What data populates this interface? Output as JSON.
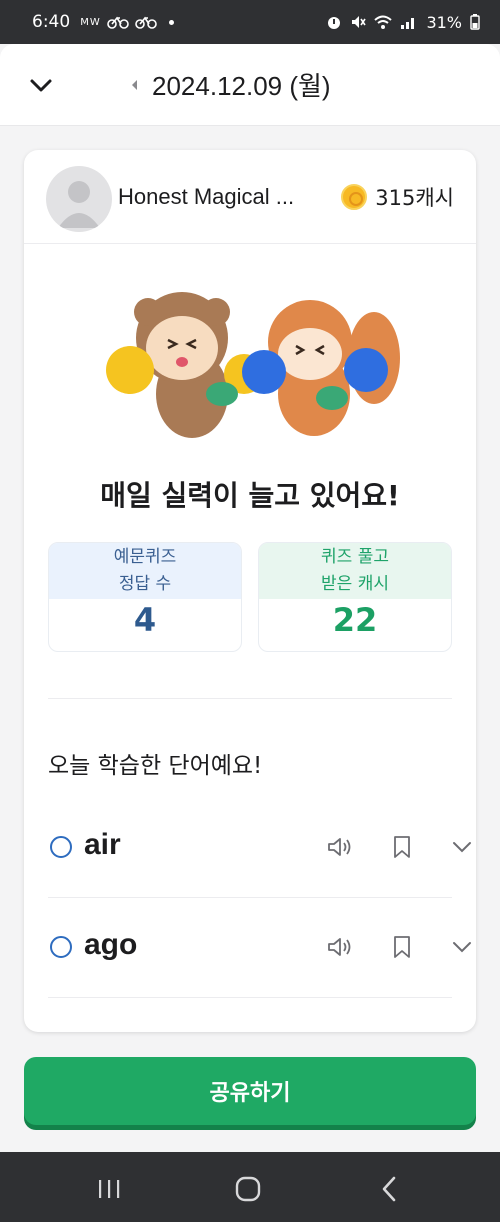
{
  "status_bar": {
    "time": "6:40",
    "left_icons_text": "MW",
    "battery": "31%"
  },
  "header": {
    "date": "2024.12.09 (월)"
  },
  "profile": {
    "name": "Honest Magical ...",
    "cash": "315캐시"
  },
  "headline": "매일 실력이 늘고 있어요!",
  "stats": [
    {
      "label_line1": "예문퀴즈",
      "label_line2": "정답 수",
      "value": "4"
    },
    {
      "label_line1": "퀴즈 풀고",
      "label_line2": "받은 캐시",
      "value": "22"
    }
  ],
  "words_section": {
    "title": "오늘 학습한 단어예요!",
    "words": [
      {
        "word": "air"
      },
      {
        "word": "ago"
      }
    ]
  },
  "share_button": {
    "label": "공유하기"
  },
  "colors": {
    "accent_green": "#1fa964",
    "quiz_blue": "#2e5a8e",
    "cash_green": "#1ca064",
    "status_bar": "#2f3033"
  },
  "icons": {
    "collapse": "chevron-down-icon",
    "prev_date": "caret-left-icon",
    "speaker": "speaker-icon",
    "bookmark": "bookmark-icon",
    "expand": "chevron-down-icon"
  }
}
